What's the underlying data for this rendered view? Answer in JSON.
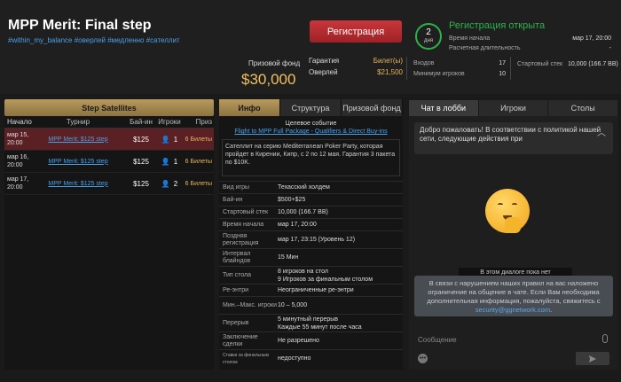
{
  "window": {
    "minimize": "—",
    "maximize": "□",
    "close": "✕"
  },
  "header": {
    "title": "MPP Merit: Final step",
    "tags": "#within_my_balance #оверлей #медленно #сателлит",
    "register_button": "Регистрация",
    "prize_label": "Призовой фонд",
    "prize_value": "$30,000",
    "guarantee_label": "Гарантия",
    "guarantee_value": "Билет(ы)",
    "overlay_label": "Оверлей",
    "overlay_value": "$21,500",
    "timer_value": "2",
    "timer_unit": "дня",
    "reg_status": "Регистрация открыта",
    "start_label": "Время начала",
    "start_value": "мар 17, 20:00",
    "duration_label": "Расчетная длительность",
    "duration_value": "-",
    "entries_label": "Входов",
    "entries_value": "17",
    "min_players_label": "Минимум игроков",
    "min_players_value": "10",
    "stack_label": "Стартовый стек",
    "stack_value": "10,000 (166.7 BB)"
  },
  "left": {
    "header": "Step Satellites",
    "columns": [
      "Начало",
      "Турнир",
      "Бай-ин",
      "Игроки",
      "Приз"
    ],
    "rows": [
      {
        "date": "мар 15,",
        "time": "20:00",
        "name": "MPP Merit: $125 step",
        "buyin": "$125",
        "players": "1",
        "prize": "6 Билеты"
      },
      {
        "date": "мар 16,",
        "time": "20:00",
        "name": "MPP Merit: $125 step",
        "buyin": "$125",
        "players": "1",
        "prize": "6 Билеты"
      },
      {
        "date": "мар 17,",
        "time": "20:00",
        "name": "MPP Merit: $125 step",
        "buyin": "$125",
        "players": "2",
        "prize": "6 Билеты"
      }
    ]
  },
  "middle": {
    "tabs": [
      "Инфо",
      "Структура",
      "Призовой фонд"
    ],
    "event_label": "Целевое событие",
    "event_link": "Flight to MPP Full Package - Qualifiers & Direct Buy-ins",
    "description": "Сателлит на серию Mediterranean Poker Party, которая пройдет в Кирении, Кипр, с 2 по 12 мая. Гарантия 3 пакета по $10K.",
    "details": [
      {
        "k": "Вид игры",
        "v": "Техасский холдем"
      },
      {
        "k": "Бай-ин",
        "v": "$500+$25"
      },
      {
        "k": "Стартовый стек",
        "v": "10,000 (166.7 BB)"
      },
      {
        "k": "Время начала",
        "v": "мар 17, 20:00"
      },
      {
        "k": "Поздняя регистрация",
        "v": "мар 17, 23:15 (Уровень 12)"
      },
      {
        "k": "Интервал блайндов",
        "v": "15 Мин"
      },
      {
        "k": "Тип стола",
        "v": "8 игроков на стол\n9 Игроков за финальным столом"
      },
      {
        "k": "Ре-энтри",
        "v": "Неограниченные ре-энтри"
      },
      {
        "k": "Мин.–Макс. игроки",
        "v": "10 – 5,000"
      },
      {
        "k": "Перерыв",
        "v": "5 минутный перерыв\nКаждые 55 минут после часа"
      },
      {
        "k": "Заключение сделки",
        "v": "Не разрешено"
      },
      {
        "k": "Ставки за финальным столом",
        "v": "недоступно"
      }
    ]
  },
  "right": {
    "tabs": [
      "Чат в лобби",
      "Игроки",
      "Столы"
    ],
    "welcome": "Добро пожаловать! В соответствии с политикой нашей сети, следующие действия при",
    "no_dialog": "В этом диалоге пока нет",
    "notice_text": "В связи с нарушением наших правил на вас наложено ограничение на общение в чате. Если Вам необходима дополнительная информация, пожалуйста, свяжитесь с",
    "notice_email": "security@ggnetwork.com",
    "notice_end": ".",
    "message_placeholder": "Сообщение"
  }
}
